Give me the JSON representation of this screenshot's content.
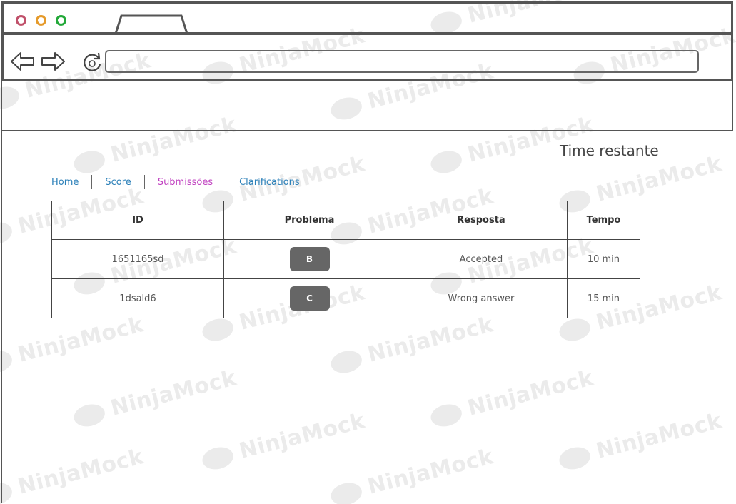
{
  "watermark": {
    "text": "NinjaMock"
  },
  "browser": {
    "address_value": ""
  },
  "page": {
    "time_label": "Time restante",
    "nav": [
      {
        "label": "Home"
      },
      {
        "label": "Score"
      },
      {
        "label": "Submissões"
      },
      {
        "label": "Clarifications"
      }
    ],
    "table": {
      "headers": [
        "ID",
        "Problema",
        "Resposta",
        "Tempo"
      ],
      "rows": [
        {
          "id": "1651165sd",
          "problema": "B",
          "resposta": "Accepted",
          "tempo": "10 min"
        },
        {
          "id": "1dsald6",
          "problema": "C",
          "resposta": "Wrong answer",
          "tempo": "15 min"
        }
      ]
    }
  },
  "colors": {
    "close": "#c0506a",
    "minimize": "#e59a2a",
    "maximize": "#22a838",
    "link": "#2a7fb8",
    "link_visited": "#c040c0",
    "badge": "#666666"
  }
}
